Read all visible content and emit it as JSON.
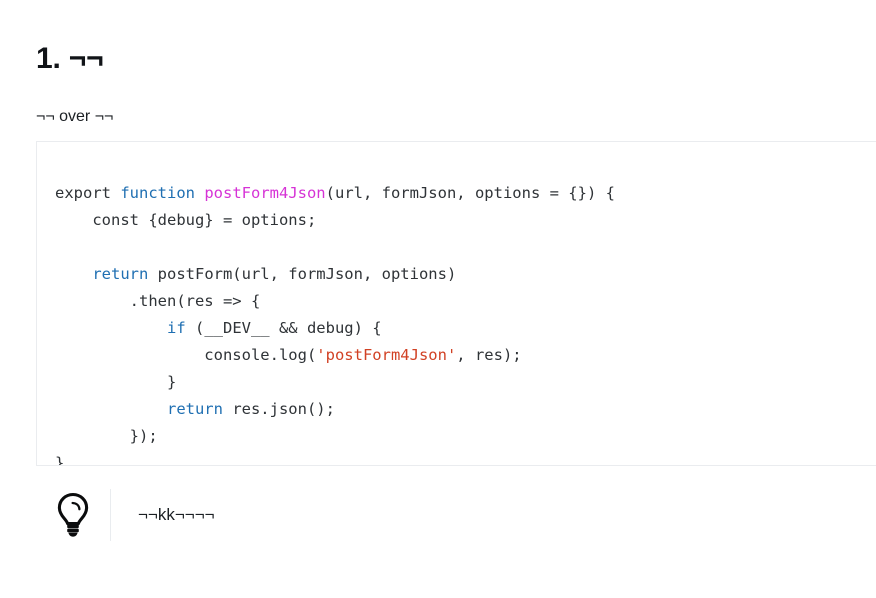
{
  "heading": "1. ¬¬",
  "subtitle": "¬¬ over ¬¬",
  "code_block": {
    "language": "javascript",
    "lines": [
      [
        {
          "text": "export ",
          "type": "plain"
        },
        {
          "text": "function ",
          "type": "keyword"
        },
        {
          "text": "postForm4Json",
          "type": "function"
        },
        {
          "text": "(url, formJson, options = {}) {",
          "type": "plain"
        }
      ],
      [
        {
          "text": "    const {debug} = options;",
          "type": "plain"
        }
      ],
      [
        {
          "text": "",
          "type": "plain"
        }
      ],
      [
        {
          "text": "    ",
          "type": "plain"
        },
        {
          "text": "return ",
          "type": "keyword"
        },
        {
          "text": "postForm(url, formJson, options)",
          "type": "plain"
        }
      ],
      [
        {
          "text": "        .then(res => {",
          "type": "plain"
        }
      ],
      [
        {
          "text": "            ",
          "type": "plain"
        },
        {
          "text": "if",
          "type": "keyword"
        },
        {
          "text": " (__DEV__ && debug) {",
          "type": "plain"
        }
      ],
      [
        {
          "text": "                console.log(",
          "type": "plain"
        },
        {
          "text": "'postForm4Json'",
          "type": "string"
        },
        {
          "text": ", res);",
          "type": "plain"
        }
      ],
      [
        {
          "text": "            }",
          "type": "plain"
        }
      ],
      [
        {
          "text": "            ",
          "type": "plain"
        },
        {
          "text": "return ",
          "type": "keyword"
        },
        {
          "text": "res.json();",
          "type": "plain"
        }
      ],
      [
        {
          "text": "        });",
          "type": "plain"
        }
      ],
      [
        {
          "text": "}",
          "type": "plain"
        }
      ]
    ]
  },
  "tip": {
    "icon": "lightbulb-icon",
    "text": "¬¬kk¬¬¬¬"
  },
  "colors": {
    "keyword": "#1f6fb2",
    "function_name": "#d633d6",
    "string": "#d14124",
    "code_text": "#2f3337",
    "border": "#eaecef",
    "divider": "#e9ecef",
    "text": "#1b1f23",
    "heading": "#111418",
    "background": "#ffffff"
  }
}
